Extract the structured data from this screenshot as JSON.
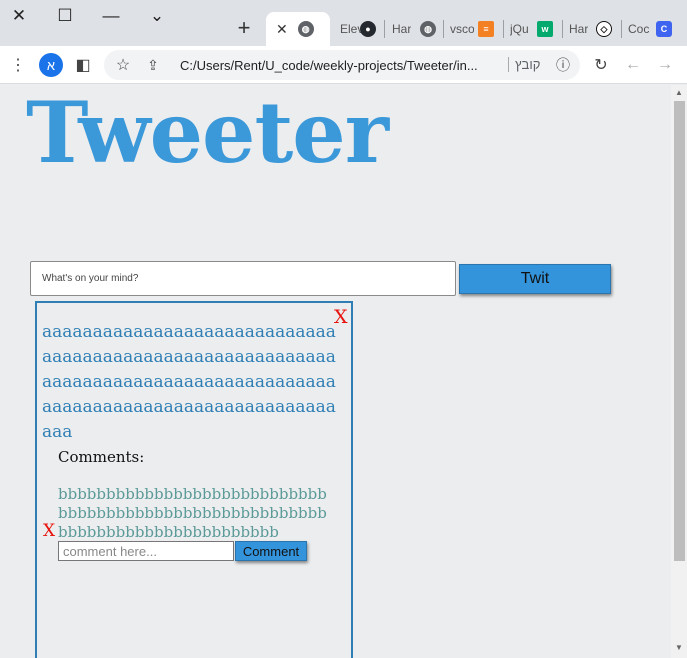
{
  "window": {
    "close_glyph": "✕",
    "maximize_glyph": "☐",
    "minimize_glyph": "—",
    "menu_glyph": "⌄"
  },
  "tabs": [
    {
      "title": "",
      "icon": "globe-icon",
      "active": true
    },
    {
      "title": "Elev",
      "icon": "globe-icon"
    },
    {
      "title": "",
      "icon": "github-icon"
    },
    {
      "title": "Har",
      "icon": "globe-icon"
    },
    {
      "title": "vsco",
      "icon": "globe-icon"
    },
    {
      "title": "",
      "icon": "stackoverflow-icon"
    },
    {
      "title": "jQu",
      "icon": "w3schools-icon"
    },
    {
      "title": "Har",
      "icon": "codepen-icon"
    },
    {
      "title": "Coc",
      "icon": "c-icon"
    }
  ],
  "toolbar": {
    "profile_initial": "א",
    "url": "C:/Users/Rent/U_code/weekly-projects/Tweeter/in...",
    "file_label": "קובץ"
  },
  "page": {
    "logo": "Tweeter",
    "post_input_placeholder": "What's on your mind?",
    "twit_button": "Twit",
    "post": {
      "delete": "X",
      "text": "aaaaaaaaaaaaaaaaaaaaaaaaaaaaaaaaaaaaaaaaaaaaaaaaaaaaaaaaaaaaaaaaaaaaaaaaaaaaaaaaaaaaaaaaaaaaaaaaaaaaaaaaaaaaaaaaaaaaaaa",
      "comments_heading": "Comments:",
      "comment": {
        "delete": "X",
        "text": "bbbbbbbbbbbbbbbbbbbbbbbbbbbbbbbbbbbbbbbbbbbbbbbbbbbbbbbbbbbbbbbbbbbbbbbbbbbbbbb"
      },
      "comment_input_placeholder": "comment here...",
      "comment_button": "Comment"
    }
  },
  "colors": {
    "brand_blue": "#3b98d9",
    "post_text": "#2f7fb5",
    "comment_text": "#5c9a98",
    "delete_red": "#e8120c"
  }
}
